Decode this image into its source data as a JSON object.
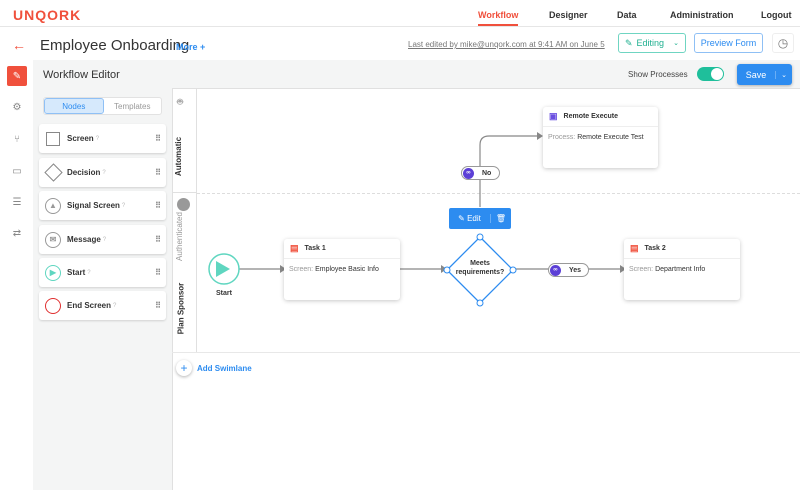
{
  "brand": "UNQORK",
  "nav": [
    {
      "label": "Workflow",
      "active": true
    },
    {
      "label": "Designer"
    },
    {
      "label": "Data"
    },
    {
      "label": "Administration"
    },
    {
      "label": "Logout"
    }
  ],
  "header": {
    "title": "Employee Onboarding",
    "more": "More +",
    "last_edited": "Last edited by mike@unqork.com at 9:41 AM on June 5",
    "mode": "Editing",
    "preview": "Preview Form"
  },
  "rail": [
    "edit-icon",
    "settings-icon",
    "branch-icon",
    "layout-icon",
    "sliders-icon",
    "swap-icon"
  ],
  "editor": {
    "title": "Workflow Editor",
    "show_processes_label": "Show Processes",
    "show_processes": true,
    "save": "Save"
  },
  "palette": {
    "tabs": [
      "Nodes",
      "Templates"
    ],
    "active_tab": "Nodes",
    "nodes": [
      "Screen",
      "Decision",
      "Signal Screen",
      "Message",
      "Start",
      "End Screen"
    ]
  },
  "lanes": {
    "automatic": "Automatic",
    "authenticated": "Authenticated",
    "plan_sponsor": "Plan Sponsor",
    "add": "Add Swimlane"
  },
  "flow": {
    "start": "Start",
    "task1": {
      "title": "Task 1",
      "key": "Screen:",
      "value": "Employee Basic Info"
    },
    "decision": "Meets requirements?",
    "edit": "Edit",
    "no": "No",
    "yes": "Yes",
    "remote": {
      "title": "Remote Execute",
      "key": "Process:",
      "value": "Remote Execute Test"
    },
    "task2": {
      "title": "Task 2",
      "key": "Screen:",
      "value": "Department Info"
    }
  },
  "colors": {
    "brand": "#f0503c",
    "primary": "#2d8cf0",
    "success": "#1fbf9b",
    "link": "#5c3fd6"
  }
}
